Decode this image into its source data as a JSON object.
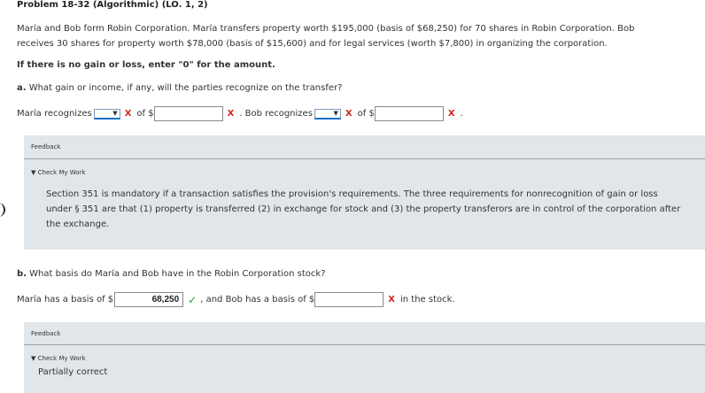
{
  "problem_title": "Problem 18-32 (Algorithmic) (LO. 1, 2)",
  "problem_text": "María and Bob form Robin Corporation. María transfers property worth $195,000 (basis of $68,250) for 70 shares in Robin Corporation. Bob receives 30 shares for property worth $78,000 (basis of $15,600) and for legal services (worth $7,800) in organizing the corporation.",
  "instruction": "If there is no gain or loss, enter \"0\" for the amount.",
  "part_a": {
    "question_prefix": "a.",
    "question": "What gain or income, if any, will the parties recognize on the transfer?",
    "maria_label": "María recognizes",
    "of_label": "of $",
    "maria_amount": "",
    "bob_label": ". Bob recognizes",
    "bob_amount": "",
    "period": ".",
    "wrong_mark": "X",
    "feedback_label": "Feedback",
    "check_label": "Check My Work",
    "feedback_text": "Section 351 is mandatory if a transaction satisfies the provision's requirements. The three requirements for nonrecognition of gain or loss under § 351 are that (1) property is transferred (2) in exchange for stock and (3) the property transferors are in control of the corporation after the exchange."
  },
  "part_b": {
    "question_prefix": "b.",
    "question": "What basis do María and Bob have in the Robin Corporation stock?",
    "maria_label": "María has a basis of $",
    "maria_amount": "68,250",
    "correct_mark": "✓",
    "bob_label": ", and Bob has a basis of $",
    "bob_amount": "",
    "wrong_mark": "X",
    "suffix": "in the stock.",
    "feedback_label": "Feedback",
    "check_label": "Check My Work",
    "status": "Partially correct"
  },
  "colors": {
    "wrong": "#d0261a",
    "correct": "#2e9a2e",
    "feedback_bg": "#e1e6ea"
  }
}
